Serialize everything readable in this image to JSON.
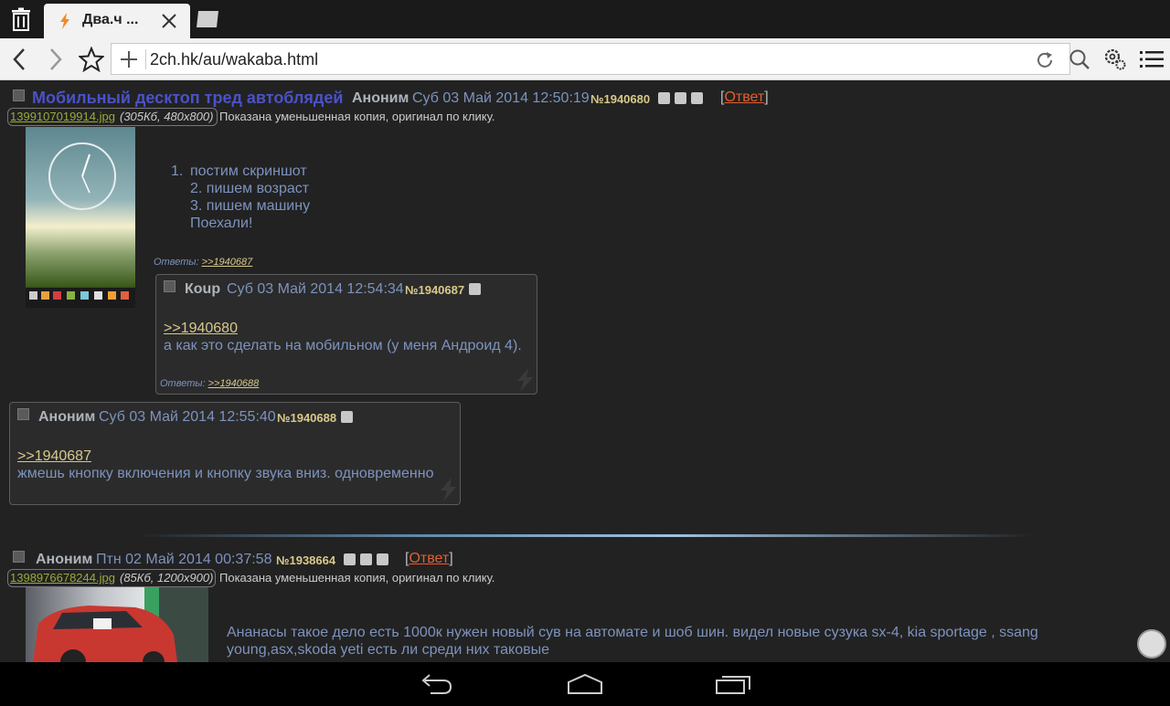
{
  "browser": {
    "tab_title": "Два.ч ...",
    "url": "2ch.hk/au/wakaba.html"
  },
  "thread": {
    "subject": "Мобильный десктоп тред автоблядей",
    "poster": "Аноним",
    "date": "Суб 03 Май 2014 12:50:19",
    "number": "№1940680",
    "reply_bracket_open": "[",
    "reply_label": "Ответ",
    "reply_bracket_close": "]",
    "file_name": "1399107019914.jpg",
    "file_meta": "(305Кб, 480x800)",
    "shown_note": "Показана уменьшенная копия, оригинал по клику.",
    "body": {
      "line1_marker": "1.",
      "line1": "постим скриншот",
      "line2": "2. пишем возраст",
      "line3": "3. пишем машину",
      "line4": "Поехали!"
    },
    "refs_label": "Ответы:",
    "refs_link": ">>1940687"
  },
  "replies": [
    {
      "poster": "Коup",
      "date": "Суб 03 Май 2014 12:54:34",
      "number": "№1940687",
      "quote": ">>1940680",
      "text": "а как это сделать на мобильном (у меня Андроид 4).",
      "refs_label": "Ответы:",
      "refs_link": ">>1940688"
    },
    {
      "poster": "Аноним",
      "date": "Суб 03 Май 2014 12:55:40",
      "number": "№1940688",
      "quote": ">>1940687",
      "text": "жмешь кнопку включения и кнопку звука вниз. одновременно"
    }
  ],
  "thread2": {
    "poster": "Аноним",
    "date": "Птн 02 Май 2014 00:37:58",
    "number": "№1938664",
    "reply_bracket_open": "[",
    "reply_label": "Ответ",
    "reply_bracket_close": "]",
    "file_name": "1398976678244.jpg",
    "file_meta": "(85Кб, 1200x900)",
    "shown_note": "Показана уменьшенная копия, оригинал по клику.",
    "body_line1": "Ананасы такое дело есть 1000к нужен новый сув на автомате и шоб шин. видел новые сузука sx-4, kia sportage , ssang",
    "body_line2": "young,asx,skoda yeti есть ли среди них таковые"
  },
  "icons": {
    "trash": "trash-icon",
    "tab_favicon": "bolt-icon",
    "tab_close": "close-icon",
    "new_tab": "new-tab-icon",
    "back": "chevron-left-icon",
    "forward": "chevron-right-icon",
    "bookmark": "star-icon",
    "url_add": "plus-icon",
    "reload": "reload-icon",
    "search": "search-icon",
    "settings": "gear-icon",
    "menu": "menu-icon",
    "nav_back": "back-icon",
    "nav_home": "home-icon",
    "nav_recent": "recent-apps-icon"
  },
  "colors": {
    "subject": "#4a52c8",
    "poster": "#aeb4bc",
    "date": "#7d93be",
    "post_number": "#d8c98a",
    "reply_link": "#e06030",
    "file_link": "#9aaa3a",
    "background": "#222222"
  }
}
